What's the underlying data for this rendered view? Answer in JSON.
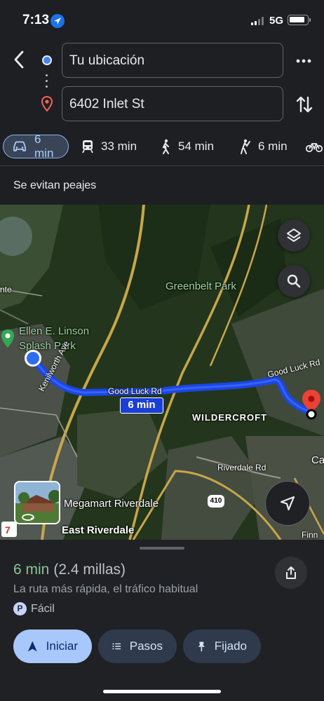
{
  "status": {
    "time": "7:13",
    "network": "5G"
  },
  "directions": {
    "origin": "Tu ubicación",
    "destination": "6402 Inlet St"
  },
  "modes": [
    {
      "icon": "car-icon",
      "label": "6 min",
      "active": true
    },
    {
      "icon": "train-icon",
      "label": "33 min"
    },
    {
      "icon": "walk-icon",
      "label": "54 min"
    },
    {
      "icon": "rideshare-icon",
      "label": "6 min"
    },
    {
      "icon": "bike-icon",
      "label": ""
    }
  ],
  "toll_note": "Se evitan peajes",
  "map": {
    "labels": {
      "greenbelt": "Greenbelt Park",
      "linson_1": "Ellen E. Linson",
      "linson_2": "Splash Park",
      "nte": "nte",
      "kenilworth": "Kenilworth Ave",
      "good_luck_1": "Good Luck Rd",
      "good_luck_2": "Good Luck Rd",
      "wildercroft": "WILDERCROFT",
      "riverdale_rd": "Riverdale Rd",
      "megamart": "Megamart Riverdale",
      "east_riverdale": "East Riverdale",
      "ca": "Ca",
      "finn": "Finn",
      "hwy": "410"
    },
    "route_time": "6 min",
    "route_color": "#1a47e6"
  },
  "summary": {
    "duration": "6 min",
    "distance": "(2.4 millas)",
    "description": "La ruta más rápida, el tráfico habitual",
    "parking": "Fácil"
  },
  "actions": {
    "start": "Iniciar",
    "steps": "Pasos",
    "pinned": "Fijado"
  }
}
